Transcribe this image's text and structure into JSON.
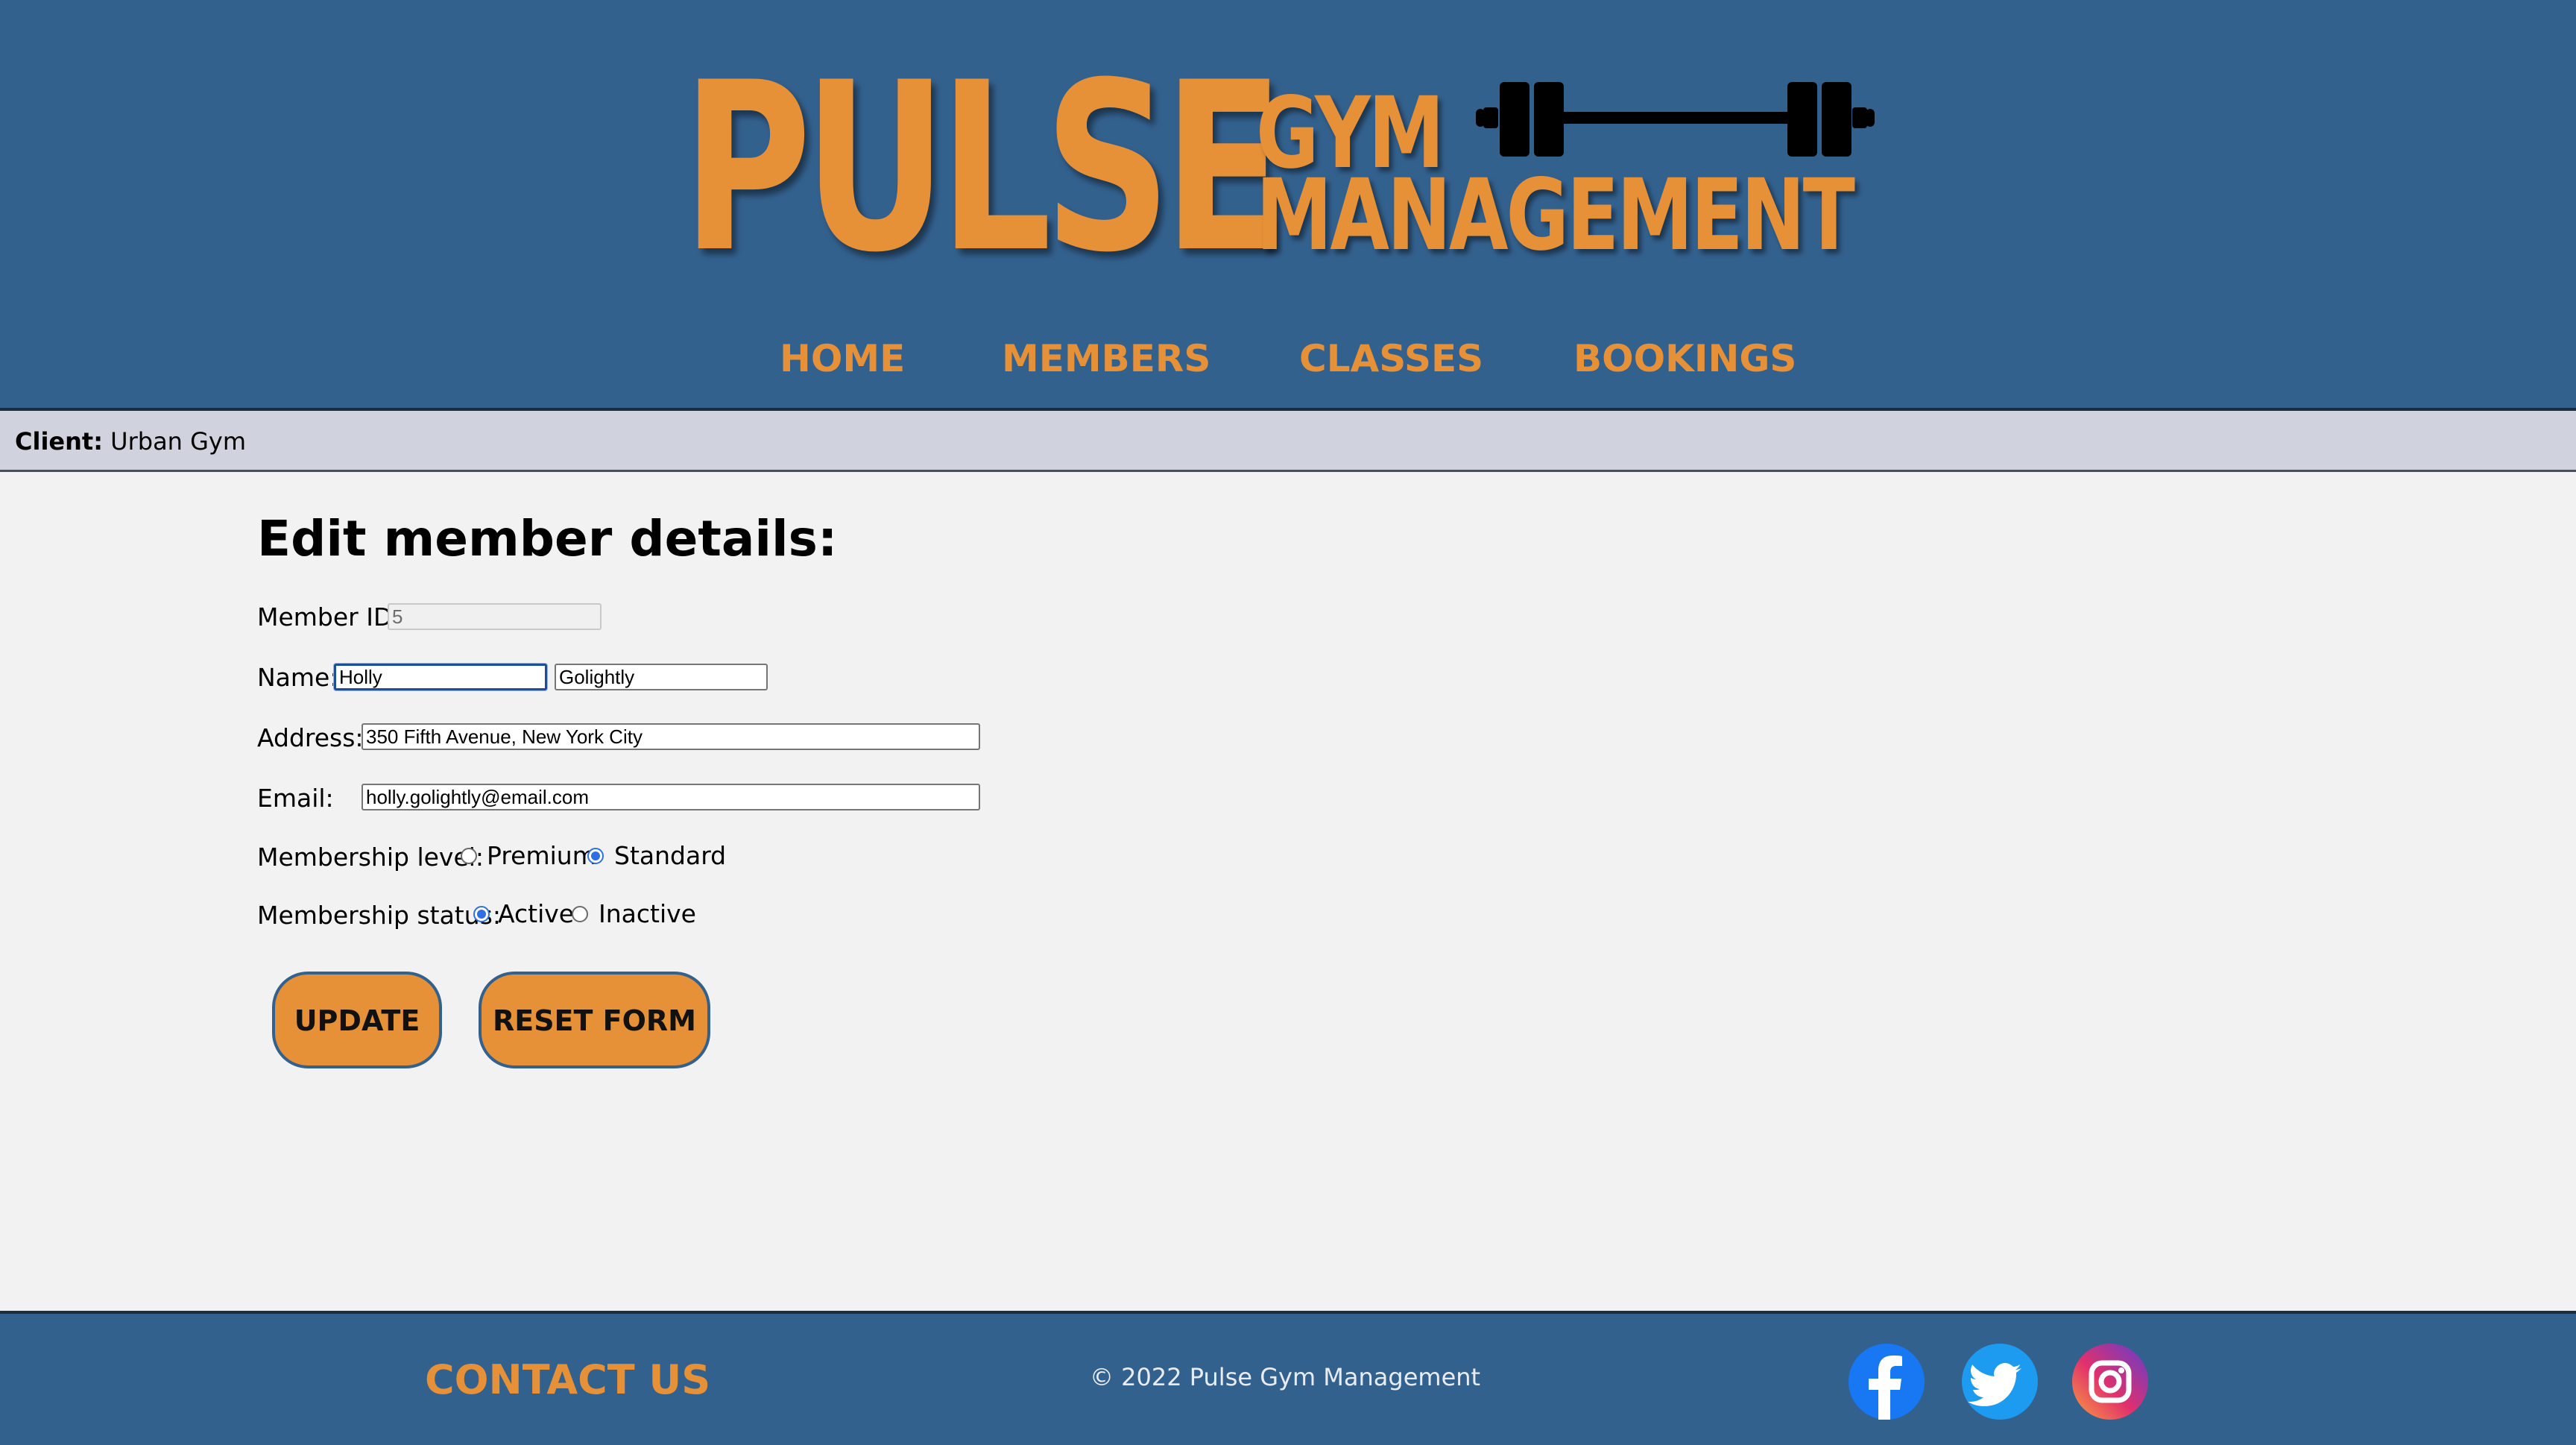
{
  "header": {
    "logo_main": "PULSE",
    "logo_line1": "GYM",
    "logo_line2": "MANAGEMENT",
    "nav": [
      "HOME",
      "MEMBERS",
      "CLASSES",
      "BOOKINGS"
    ]
  },
  "client_bar": {
    "label": "Client:",
    "value": "Urban Gym"
  },
  "form": {
    "heading": "Edit member details:",
    "member_id": {
      "label": "Member ID:",
      "value": "5"
    },
    "name": {
      "label": "Name:",
      "first": "Holly",
      "last": "Golightly"
    },
    "address": {
      "label": "Address:",
      "value": "350 Fifth Avenue, New York City"
    },
    "email": {
      "label": "Email:",
      "value": "holly.golightly@email.com"
    },
    "membership_level": {
      "label": "Membership level:",
      "options": [
        "Premium",
        "Standard"
      ],
      "selected": "Standard"
    },
    "membership_status": {
      "label": "Membership status:",
      "options": [
        "Active",
        "Inactive"
      ],
      "selected": "Active"
    },
    "update_label": "UPDATE",
    "reset_label": "RESET FORM"
  },
  "footer": {
    "contact": "CONTACT US",
    "copyright": "© 2022 Pulse Gym Management",
    "social_icons": [
      "facebook-icon",
      "twitter-icon",
      "instagram-icon"
    ]
  },
  "colors": {
    "brand_blue": "#33618e",
    "accent_orange": "#e69138",
    "client_bar": "#d0d3dd",
    "background": "#f2f2f2"
  }
}
